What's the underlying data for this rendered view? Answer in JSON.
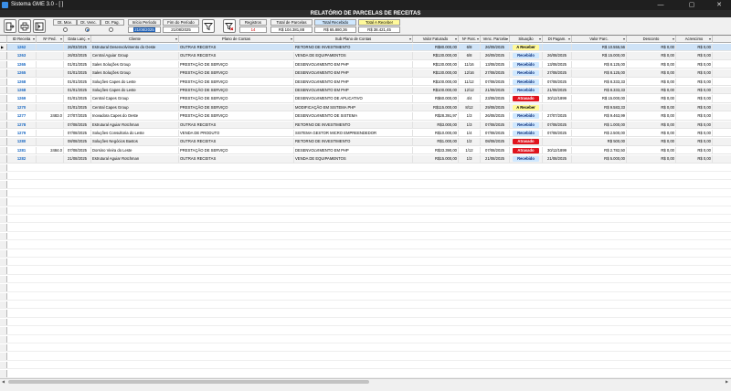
{
  "window": {
    "title": "Sistema GME 3.0 - [ ]",
    "controls": {
      "minimize": "—",
      "maximize": "▢",
      "close": "✕"
    }
  },
  "report_title": "RELATÓRIO DE PARCELAS DE RECEITAS",
  "toolbar": {
    "buttons": [
      "exit-icon",
      "print-icon",
      "export-icon"
    ],
    "filters": {
      "dt_mov": "Dt. Mov.",
      "dt_venc": "Dt. Venc.",
      "dt_pag": "Dt. Pag.",
      "selected": "dt_venc"
    },
    "inicio_label": "Início Período",
    "inicio_value": "21/08/2025",
    "fim_label": "Fim do Período",
    "fim_value": "21/08/2025",
    "registros_label": "Registros",
    "registros_value": "14",
    "total_parcelas_label": "Total de Parcelas",
    "total_parcelas_value": "R$ 104.381,88",
    "total_recebido_label": "Total Recebido",
    "total_recebido_value": "R$ 65.880,36",
    "total_receber_label": "Total A Receber",
    "total_receber_value": "R$ 38.421,45"
  },
  "table": {
    "headers": [
      "ID Receita",
      "Nº Ped.",
      "Data Lanç.",
      "Cliente",
      "Plano de Contas",
      "Sub Plano de Contas",
      "Valor Faturado",
      "Nº Parc.",
      "Venc. Parcela",
      "Situação",
      "Dt Pagam.",
      "Valor Parc.",
      "Desconto",
      "Acrescimo"
    ],
    "rows": [
      [
        "1262",
        "",
        "26/03/2025",
        "Estrutural Desenvolvimento do Oeste",
        "OUTRAS RECEITAS",
        "RETORNO DE INVESTIMENTO",
        "R$80.000,00",
        "6/8",
        "26/09/2025",
        "A Receber",
        "",
        "R$ 10.555,56",
        "R$ 0,00",
        "R$ 0,00"
      ],
      [
        "1263",
        "",
        "26/03/2025",
        "Central Aguiar Group",
        "OUTRAS RECEITAS",
        "VENDA DE EQUIPAMENTOS",
        "R$130.000,00",
        "6/8",
        "26/09/2025",
        "Recebido",
        "26/08/2025",
        "R$ 15.000,00",
        "R$ 0,00",
        "R$ 0,00"
      ],
      [
        "1265",
        "",
        "01/01/2025",
        "Sales Soluções Group",
        "PRESTAÇÃO DE SERVIÇO",
        "DESENVOLVIMENTO EM PHP",
        "R$130.000,00",
        "11/16",
        "13/08/2025",
        "Recebido",
        "13/08/2025",
        "R$ 8.125,00",
        "R$ 0,00",
        "R$ 0,00"
      ],
      [
        "1265",
        "",
        "01/01/2025",
        "Sales Soluções Group",
        "PRESTAÇÃO DE SERVIÇO",
        "DESENVOLVIMENTO EM PHP",
        "R$130.000,00",
        "12/16",
        "27/08/2025",
        "Recebido",
        "27/08/2025",
        "R$ 8.125,00",
        "R$ 0,00",
        "R$ 0,00"
      ],
      [
        "1268",
        "",
        "01/01/2025",
        "Soluções Capes do Leste",
        "PRESTAÇÃO DE SERVIÇO",
        "DESENVOLVIMENTO EM PHP",
        "R$100.000,00",
        "11/12",
        "07/08/2025",
        "Recebido",
        "07/08/2025",
        "R$ 8.333,33",
        "R$ 0,00",
        "R$ 0,00"
      ],
      [
        "1268",
        "",
        "01/01/2025",
        "Soluções Capes do Leste",
        "PRESTAÇÃO DE SERVIÇO",
        "DESENVOLVIMENTO EM PHP",
        "R$100.000,00",
        "12/12",
        "21/08/2025",
        "Recebido",
        "21/08/2025",
        "R$ 8.333,33",
        "R$ 0,00",
        "R$ 0,00"
      ],
      [
        "1269",
        "",
        "01/01/2025",
        "Central Capes Group",
        "PRESTAÇÃO DE SERVIÇO",
        "DESENVOLVIMENTO DE APLICATIVO",
        "R$60.000,00",
        "4/4",
        "23/08/2025",
        "Atrasado",
        "30/12/1899",
        "R$ 15.000,00",
        "R$ 0,00",
        "R$ 0,00"
      ],
      [
        "1270",
        "",
        "01/01/2025",
        "Central Capes Group",
        "PRESTAÇÃO DE SERVIÇO",
        "MODIFICAÇÃO EM SISTEMA PHP",
        "R$115.000,00",
        "8/12",
        "29/08/2025",
        "A Receber",
        "",
        "R$ 9.583,33",
        "R$ 0,00",
        "R$ 0,00"
      ],
      [
        "1277",
        "2483.0",
        "27/07/2025",
        "Inovadora Capes do Oeste",
        "PRESTAÇÃO DE SERVIÇO",
        "DESENVOLVIMENTO DE SISTEMA",
        "R$28.391,97",
        "1/3",
        "26/08/2025",
        "Recebido",
        "27/07/2025",
        "R$ 9.463,99",
        "R$ 0,00",
        "R$ 0,00"
      ],
      [
        "1278",
        "",
        "07/08/2025",
        "Estrutural Aguiar Rotchman",
        "OUTRAS RECEITAS",
        "RETORNO DE INVESTIMENTO",
        "R$3.000,00",
        "1/3",
        "07/08/2025",
        "Recebido",
        "07/08/2025",
        "R$ 1.000,00",
        "R$ 0,00",
        "R$ 0,00"
      ],
      [
        "1279",
        "",
        "07/08/2025",
        "Soluções Consultoria do Leste",
        "VENDA DE PRODUTO",
        "SISTEMA GESTOR MICRO EMPREENDEDOR",
        "R$10.000,00",
        "1/4",
        "07/08/2025",
        "Recebido",
        "07/08/2025",
        "R$ 2.500,00",
        "R$ 0,00",
        "R$ 0,00"
      ],
      [
        "1280",
        "",
        "08/08/2025",
        "Soluções Negócios Bastos",
        "OUTRAS RECEITAS",
        "RETORNO DE INVESTIMENTO",
        "R$1.000,00",
        "1/2",
        "08/08/2025",
        "Atrasado",
        "",
        "R$ 500,00",
        "R$ 0,00",
        "R$ 0,00"
      ],
      [
        "1281",
        "2484.0",
        "07/08/2025",
        "Dorsino Vieira do Leste",
        "PRESTAÇÃO DE SERVIÇO",
        "DESENVOLVIMENTO EM PHP",
        "R$33.390,00",
        "1/12",
        "07/08/2025",
        "Atrasado",
        "30/12/1899",
        "R$ 2.782,50",
        "R$ 0,00",
        "R$ 0,00"
      ],
      [
        "1282",
        "",
        "21/08/2025",
        "Estrutural Aguiar Rotchman",
        "OUTRAS RECEITAS",
        "VENDA DE EQUIPAMENTOS",
        "R$15.000,00",
        "1/3",
        "21/08/2025",
        "Recebido",
        "21/08/2025",
        "R$ 5.000,00",
        "R$ 0,00",
        "R$ 0,00"
      ]
    ],
    "status_colors": {
      "Recebido": "#cfe8ff",
      "Atrasado": "#e0141e",
      "A Receber": "#fff99a"
    }
  }
}
